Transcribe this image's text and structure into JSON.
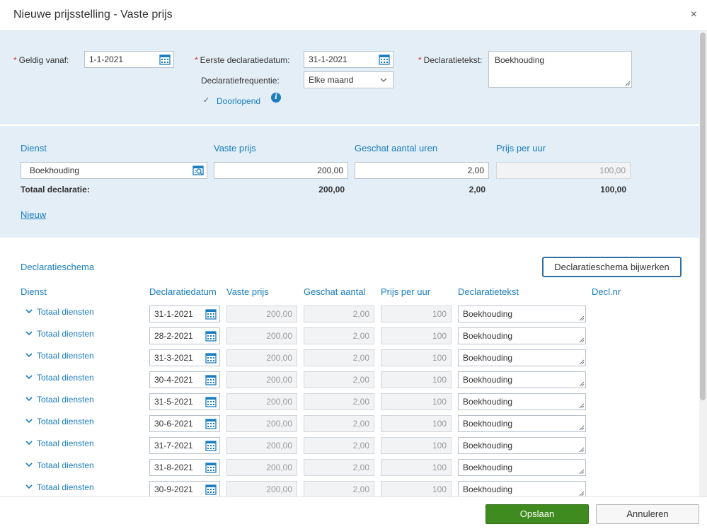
{
  "dialog": {
    "title": "Nieuwe prijsstelling - Vaste prijs",
    "close_symbol": "×"
  },
  "header": {
    "required_marker": "*",
    "geldig_vanaf_label": "Geldig vanaf:",
    "geldig_vanaf_value": "1-1-2021",
    "eerste_declaratiedatum_label": "Eerste declaratiedatum:",
    "eerste_declaratiedatum_value": "31-1-2021",
    "declaratiefrequentie_label": "Declaratiefrequentie:",
    "declaratiefrequentie_value": "Elke maand",
    "declaratietekst_label": "Declaratietekst:",
    "declaratietekst_value": "Boekhouding",
    "doorlopend_label": "Doorlopend",
    "doorlopend_checked": true,
    "info_symbol": "i"
  },
  "services": {
    "columns": [
      "Dienst",
      "Vaste prijs",
      "Geschat aantal uren",
      "Prijs per uur"
    ],
    "row": {
      "dienst": "Boekhouding",
      "vaste_prijs": "200,00",
      "uren": "2,00",
      "prijs_per_uur": "100,00"
    },
    "totals": {
      "label": "Totaal declaratie:",
      "vaste_prijs": "200,00",
      "uren": "2,00",
      "prijs_per_uur": "100,00"
    },
    "new_link": "Nieuw"
  },
  "schedule": {
    "title": "Declaratieschema",
    "update_button": "Declaratieschema bijwerken",
    "columns": [
      "Dienst",
      "Declaratiedatum",
      "Vaste prijs",
      "Geschat aantal",
      "Prijs per uur",
      "Declaratietekst",
      "Decl.nr"
    ],
    "rows": [
      {
        "dienst": "Totaal diensten",
        "datum": "31-1-2021",
        "vaste_prijs": "200,00",
        "aantal": "2,00",
        "prijs_per_uur": "100",
        "tekst": "Boekhouding"
      },
      {
        "dienst": "Totaal diensten",
        "datum": "28-2-2021",
        "vaste_prijs": "200,00",
        "aantal": "2,00",
        "prijs_per_uur": "100",
        "tekst": "Boekhouding"
      },
      {
        "dienst": "Totaal diensten",
        "datum": "31-3-2021",
        "vaste_prijs": "200,00",
        "aantal": "2,00",
        "prijs_per_uur": "100",
        "tekst": "Boekhouding"
      },
      {
        "dienst": "Totaal diensten",
        "datum": "30-4-2021",
        "vaste_prijs": "200,00",
        "aantal": "2,00",
        "prijs_per_uur": "100",
        "tekst": "Boekhouding"
      },
      {
        "dienst": "Totaal diensten",
        "datum": "31-5-2021",
        "vaste_prijs": "200,00",
        "aantal": "2,00",
        "prijs_per_uur": "100",
        "tekst": "Boekhouding"
      },
      {
        "dienst": "Totaal diensten",
        "datum": "30-6-2021",
        "vaste_prijs": "200,00",
        "aantal": "2,00",
        "prijs_per_uur": "100",
        "tekst": "Boekhouding"
      },
      {
        "dienst": "Totaal diensten",
        "datum": "31-7-2021",
        "vaste_prijs": "200,00",
        "aantal": "2,00",
        "prijs_per_uur": "100",
        "tekst": "Boekhouding"
      },
      {
        "dienst": "Totaal diensten",
        "datum": "31-8-2021",
        "vaste_prijs": "200,00",
        "aantal": "2,00",
        "prijs_per_uur": "100",
        "tekst": "Boekhouding"
      },
      {
        "dienst": "Totaal diensten",
        "datum": "30-9-2021",
        "vaste_prijs": "200,00",
        "aantal": "2,00",
        "prijs_per_uur": "100",
        "tekst": "Boekhouding"
      }
    ]
  },
  "footer": {
    "save_label": "Opslaan",
    "cancel_label": "Annuleren"
  },
  "colors": {
    "accent": "#1a7dc0",
    "panel": "#e3eef7",
    "primary": "#3f8b1f",
    "required": "#d0312d"
  }
}
